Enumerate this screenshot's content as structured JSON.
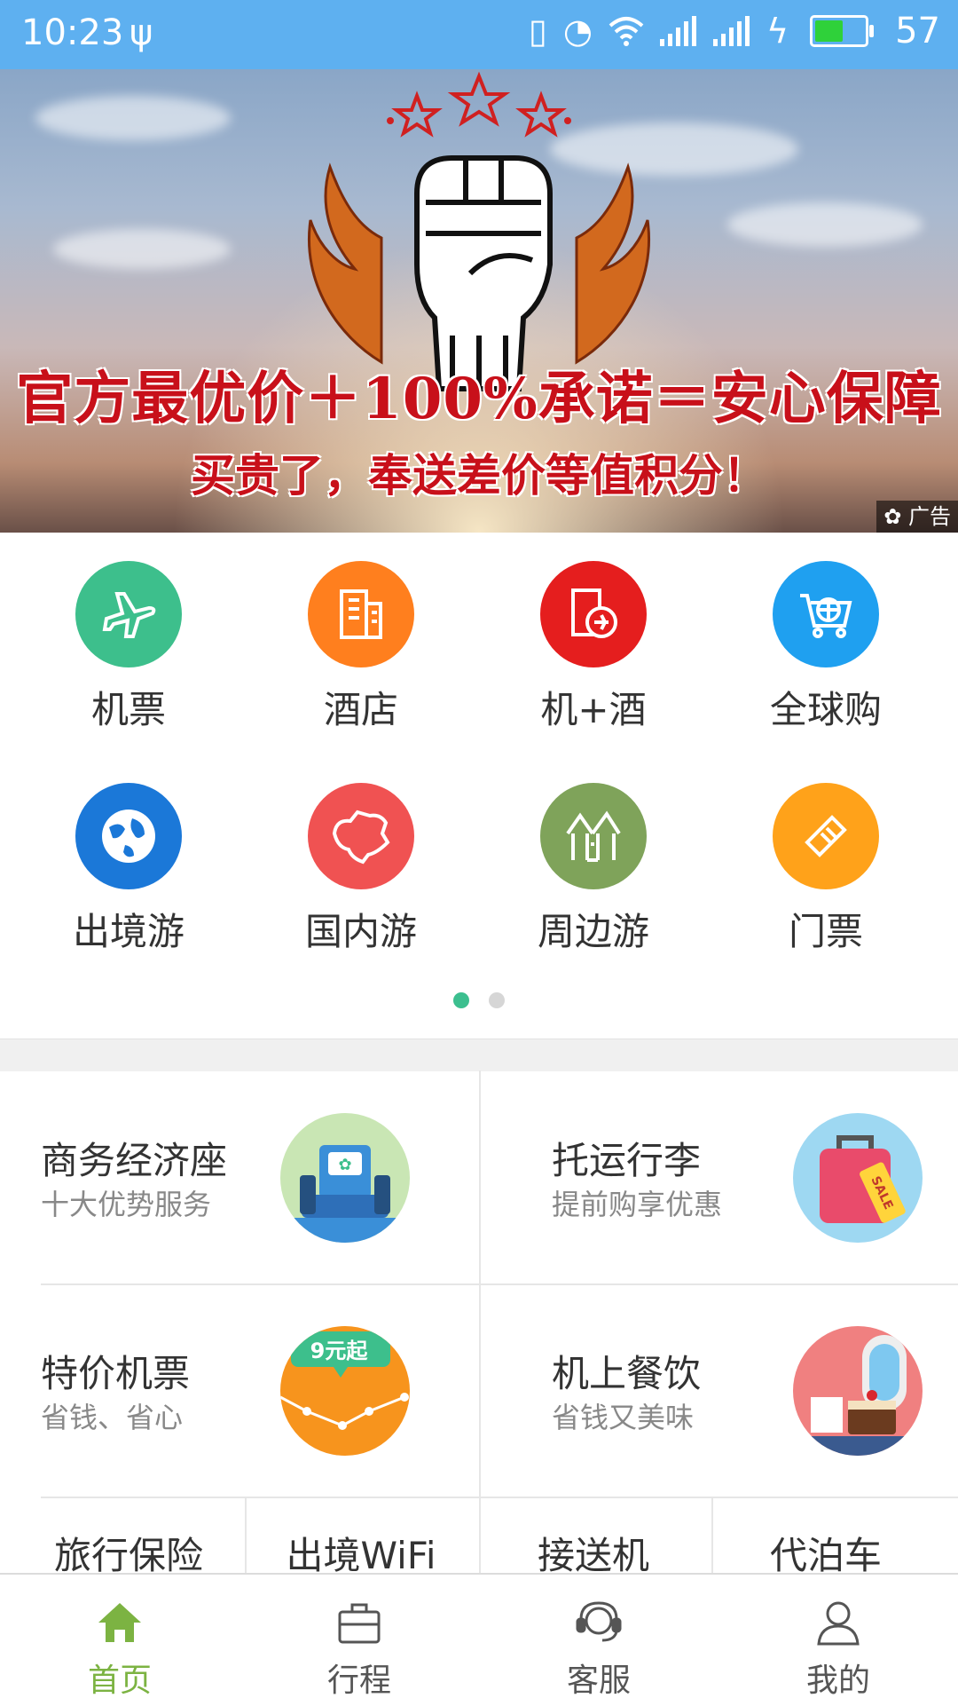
{
  "status_bar": {
    "time": "10:23",
    "battery_level": "57",
    "battery_fraction": 0.57,
    "icons": [
      "usb-icon",
      "vibrate-icon",
      "alarm-icon",
      "wifi-icon",
      "signal-icon",
      "signal-icon",
      "charging-icon",
      "battery-icon"
    ]
  },
  "banner": {
    "headline": "官方最优价＋100%承诺＝安心保障",
    "subline": "买贵了，奉送差价等值积分！",
    "ad_tag": "广告"
  },
  "categories": [
    {
      "label": "机票",
      "icon": "plane-icon",
      "color": "#3dbf8c"
    },
    {
      "label": "酒店",
      "icon": "building-icon",
      "color": "#ff7f1e"
    },
    {
      "label": "机+酒",
      "icon": "flight-hotel-icon",
      "color": "#e51e1e"
    },
    {
      "label": "全球购",
      "icon": "cart-globe-icon",
      "color": "#1fa0f0"
    },
    {
      "label": "出境游",
      "icon": "globe-icon",
      "color": "#1b78d8"
    },
    {
      "label": "国内游",
      "icon": "china-map-icon",
      "color": "#f05252"
    },
    {
      "label": "周边游",
      "icon": "house-icon",
      "color": "#7fa35a"
    },
    {
      "label": "门票",
      "icon": "ticket-icon",
      "color": "#ffa21a"
    }
  ],
  "pager": {
    "current": 1,
    "total": 2
  },
  "promos": [
    {
      "title": "商务经济座",
      "subtitle": "十大优势服务",
      "icon": "seat-icon"
    },
    {
      "title": "托运行李",
      "subtitle": "提前购享优惠",
      "icon": "luggage-sale-icon",
      "badge": "SALE"
    },
    {
      "title": "特价机票",
      "subtitle": "省钱、省心",
      "icon": "price-chart-icon",
      "badge": "9元起"
    },
    {
      "title": "机上餐饮",
      "subtitle": "省钱又美味",
      "icon": "inflight-meal-icon"
    }
  ],
  "services": [
    "旅行保险",
    "出境WiFi",
    "接送机",
    "代泊车"
  ],
  "bottom_nav": [
    {
      "label": "首页",
      "icon": "home-icon",
      "active": true
    },
    {
      "label": "行程",
      "icon": "briefcase-icon",
      "active": false
    },
    {
      "label": "客服",
      "icon": "headset-icon",
      "active": false
    },
    {
      "label": "我的",
      "icon": "user-icon",
      "active": false
    }
  ],
  "colors": {
    "status_bar": "#5eb0f0",
    "active_nav": "#7cb342",
    "pager_active": "#3cbf8f"
  }
}
